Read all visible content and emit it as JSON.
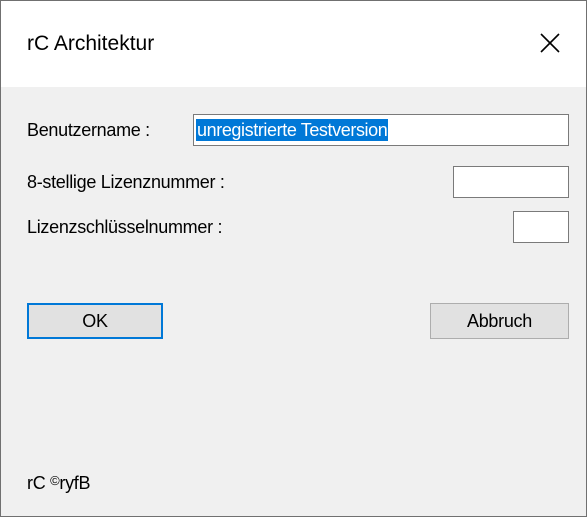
{
  "window": {
    "title": "rC Architektur",
    "close_icon": "close-icon"
  },
  "form": {
    "username_label": "Benutzername :",
    "username_value": "unregistrierte Testversion",
    "license_label": "8-stellige Lizenznummer :",
    "license_value": "",
    "key_label": "Lizenzschlüsselnummer :",
    "key_value": ""
  },
  "buttons": {
    "ok": "OK",
    "cancel": "Abbruch"
  },
  "footer": {
    "prefix": "rC",
    "symbol": "©",
    "suffix": "ryfB"
  },
  "colors": {
    "selection": "#0078d7",
    "client_bg": "#f0f0f0",
    "default_button_border": "#0078d7"
  }
}
